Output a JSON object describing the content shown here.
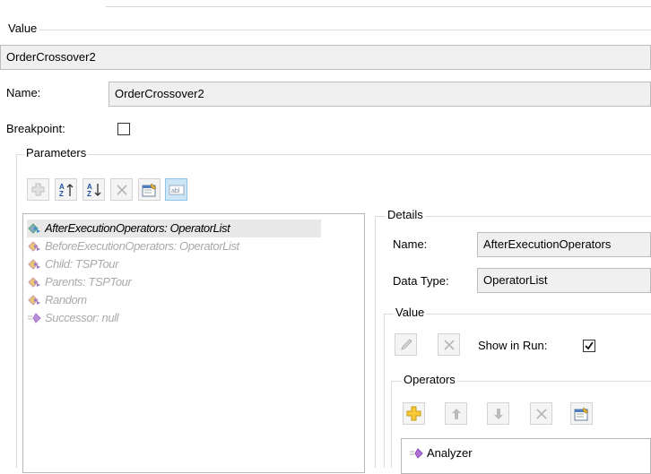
{
  "value_group": {
    "title": "Value",
    "field_value": "OrderCrossover2"
  },
  "name_row": {
    "label": "Name:",
    "value": "OrderCrossover2"
  },
  "breakpoint": {
    "label": "Breakpoint:",
    "checked": false
  },
  "parameters": {
    "title": "Parameters",
    "toolbar": [
      "add-icon",
      "sort-ascending-icon",
      "sort-descending-icon",
      "remove-icon",
      "properties-icon",
      "text-field-icon"
    ],
    "items": [
      {
        "text": "AfterExecutionOperators: OperatorList",
        "icon": "parameter-icon",
        "state": "selected"
      },
      {
        "text": "BeforeExecutionOperators: OperatorList",
        "icon": "parameter-icon",
        "state": "disabled"
      },
      {
        "text": "Child: TSPTour",
        "icon": "parameter-icon",
        "state": "disabled"
      },
      {
        "text": "Parents: TSPTour",
        "icon": "parameter-icon",
        "state": "disabled"
      },
      {
        "text": "Random",
        "icon": "parameter-icon",
        "state": "disabled"
      },
      {
        "text": "Successor: null",
        "icon": "operator-icon",
        "state": "disabled"
      }
    ]
  },
  "details": {
    "title": "Details",
    "name_label": "Name:",
    "name_value": "AfterExecutionOperators",
    "datatype_label": "Data Type:",
    "datatype_value": "OperatorList",
    "value_title": "Value",
    "show_in_run_label": "Show in Run:",
    "show_in_run_checked": true,
    "operators_title": "Operators",
    "operators": [
      {
        "text": "Analyzer",
        "icon": "operator-icon"
      }
    ]
  },
  "colors": {
    "selection": "#e8e8e8",
    "disabled_text": "#aaaaaa",
    "active_button": "#cde6f7"
  }
}
